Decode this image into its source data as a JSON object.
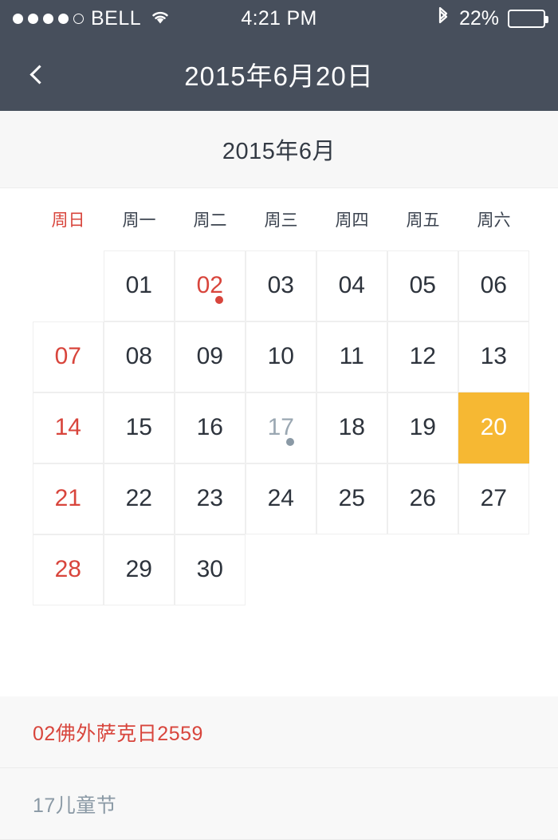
{
  "status_bar": {
    "signal_dots_filled": 4,
    "signal_dots_total": 5,
    "carrier": "BELL",
    "wifi_icon": "wifi-icon",
    "time": "4:21 PM",
    "bluetooth_icon": "bluetooth-icon",
    "battery_percent": "22%",
    "battery_fill_ratio": 22
  },
  "nav_bar": {
    "back_icon": "chevron-left-icon",
    "title": "2015年6月20日"
  },
  "month_header": {
    "label": "2015年6月"
  },
  "weekdays": [
    {
      "label": "周日",
      "is_sunday": true
    },
    {
      "label": "周一",
      "is_sunday": false
    },
    {
      "label": "周二",
      "is_sunday": false
    },
    {
      "label": "周三",
      "is_sunday": false
    },
    {
      "label": "周四",
      "is_sunday": false
    },
    {
      "label": "周五",
      "is_sunday": false
    },
    {
      "label": "周六",
      "is_sunday": false
    }
  ],
  "calendar": {
    "year": 2015,
    "month": 6,
    "selected_day": "20",
    "first_weekday_offset": 1,
    "days": [
      {
        "label": "01",
        "weekday": 1,
        "style": "normal",
        "marker": null
      },
      {
        "label": "02",
        "weekday": 2,
        "style": "holiday",
        "marker": "red"
      },
      {
        "label": "03",
        "weekday": 3,
        "style": "normal",
        "marker": null
      },
      {
        "label": "04",
        "weekday": 4,
        "style": "normal",
        "marker": null
      },
      {
        "label": "05",
        "weekday": 5,
        "style": "normal",
        "marker": null
      },
      {
        "label": "06",
        "weekday": 6,
        "style": "normal",
        "marker": null
      },
      {
        "label": "07",
        "weekday": 0,
        "style": "sunday",
        "marker": null
      },
      {
        "label": "08",
        "weekday": 1,
        "style": "normal",
        "marker": null
      },
      {
        "label": "09",
        "weekday": 2,
        "style": "normal",
        "marker": null
      },
      {
        "label": "10",
        "weekday": 3,
        "style": "normal",
        "marker": null
      },
      {
        "label": "11",
        "weekday": 4,
        "style": "normal",
        "marker": null
      },
      {
        "label": "12",
        "weekday": 5,
        "style": "normal",
        "marker": null
      },
      {
        "label": "13",
        "weekday": 6,
        "style": "normal",
        "marker": null
      },
      {
        "label": "14",
        "weekday": 0,
        "style": "sunday",
        "marker": null
      },
      {
        "label": "15",
        "weekday": 1,
        "style": "normal",
        "marker": null
      },
      {
        "label": "16",
        "weekday": 2,
        "style": "normal",
        "marker": null
      },
      {
        "label": "17",
        "weekday": 3,
        "style": "muted",
        "marker": "grey"
      },
      {
        "label": "18",
        "weekday": 4,
        "style": "normal",
        "marker": null
      },
      {
        "label": "19",
        "weekday": 5,
        "style": "normal",
        "marker": null
      },
      {
        "label": "20",
        "weekday": 6,
        "style": "selected",
        "marker": null
      },
      {
        "label": "21",
        "weekday": 0,
        "style": "sunday",
        "marker": null
      },
      {
        "label": "22",
        "weekday": 1,
        "style": "normal",
        "marker": null
      },
      {
        "label": "23",
        "weekday": 2,
        "style": "normal",
        "marker": null
      },
      {
        "label": "24",
        "weekday": 3,
        "style": "normal",
        "marker": null
      },
      {
        "label": "25",
        "weekday": 4,
        "style": "normal",
        "marker": null
      },
      {
        "label": "26",
        "weekday": 5,
        "style": "normal",
        "marker": null
      },
      {
        "label": "27",
        "weekday": 6,
        "style": "normal",
        "marker": null
      },
      {
        "label": "28",
        "weekday": 0,
        "style": "sunday",
        "marker": null
      },
      {
        "label": "29",
        "weekday": 1,
        "style": "normal",
        "marker": null
      },
      {
        "label": "30",
        "weekday": 2,
        "style": "normal",
        "marker": null
      }
    ]
  },
  "events": [
    {
      "text": "02佛外萨克日2559",
      "style": "red"
    },
    {
      "text": "17儿童节",
      "style": "grey"
    }
  ],
  "colors": {
    "nav_background": "#474F5C",
    "selected_day": "#F6B833",
    "holiday_red": "#D8453C",
    "muted_blue_grey": "#8A99A5",
    "grid_line": "#EFEFEF",
    "month_header_bg": "#F7F7F7",
    "events_bg": "#F8F8F8"
  }
}
